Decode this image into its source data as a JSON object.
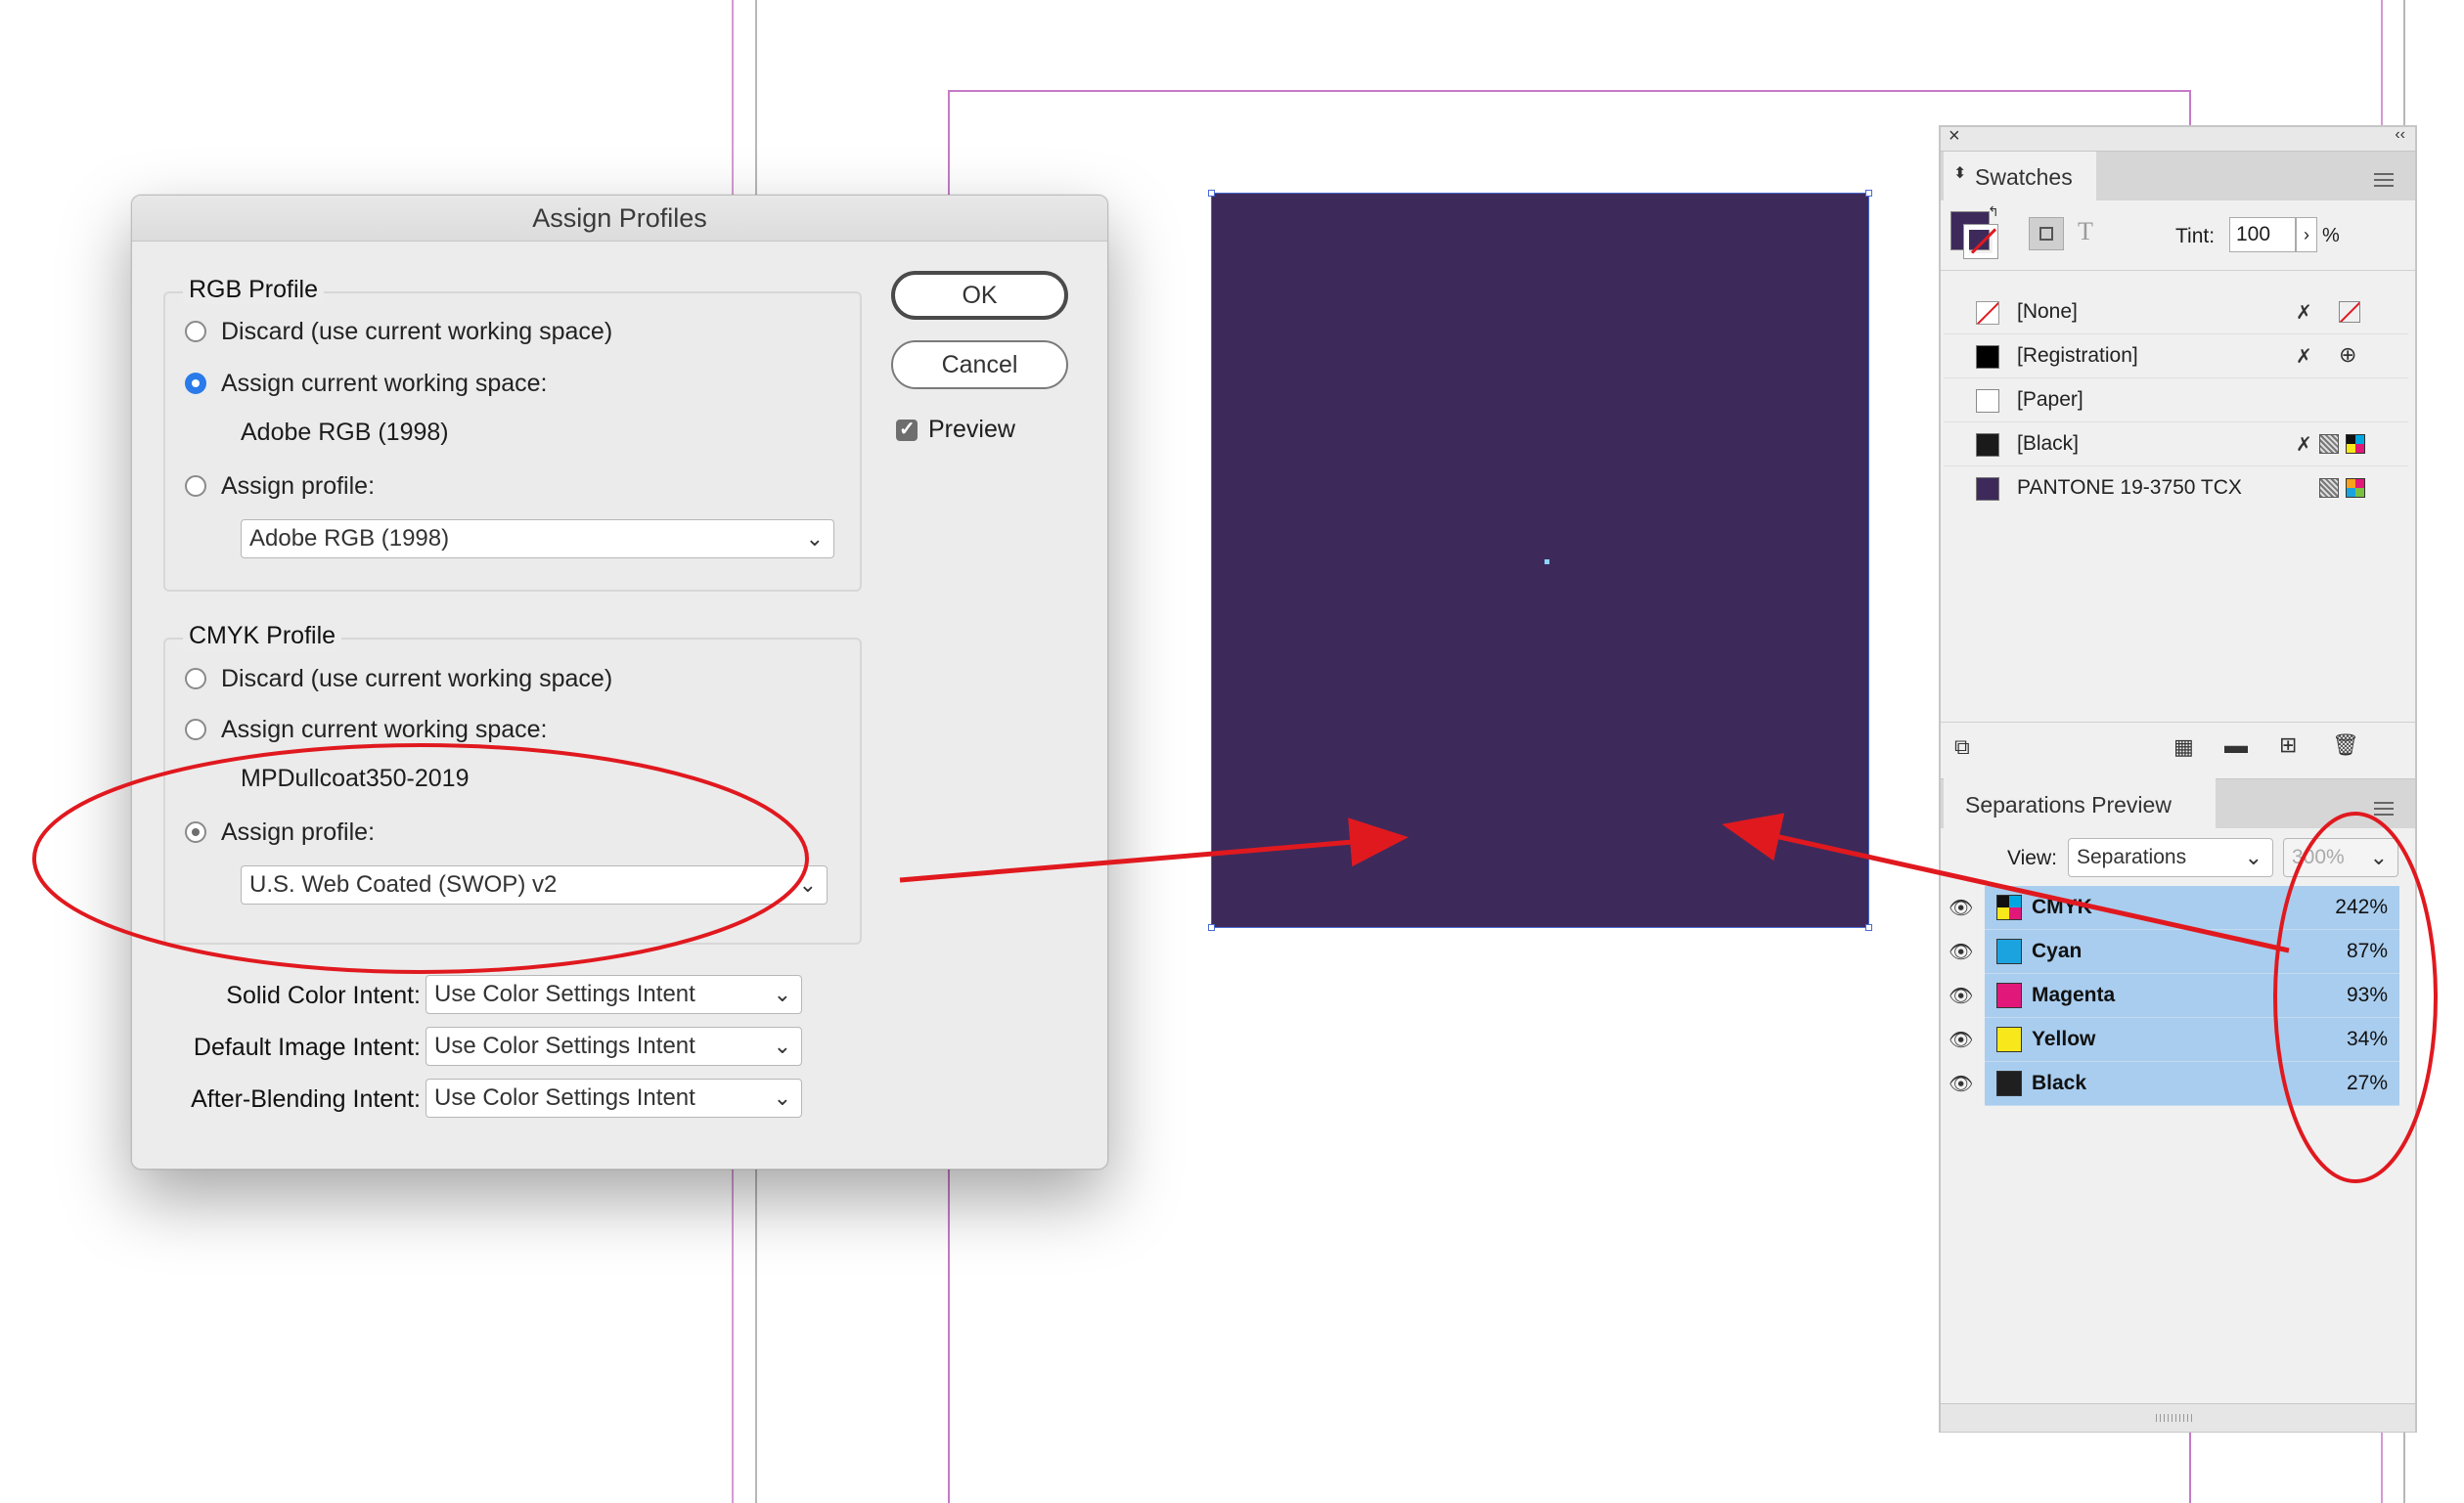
{
  "dialog": {
    "title": "Assign Profiles",
    "rgb": {
      "title": "RGB Profile",
      "discard_label": "Discard (use current working space)",
      "assign_current_label": "Assign current working space:",
      "current_space": "Adobe RGB (1998)",
      "assign_profile_label": "Assign profile:",
      "profile_select_value": "Adobe RGB (1998)",
      "selected": "assign_current"
    },
    "cmyk": {
      "title": "CMYK Profile",
      "discard_label": "Discard (use current working space)",
      "assign_current_label": "Assign current working space:",
      "current_space": "MPDullcoat350-2019",
      "assign_profile_label": "Assign profile:",
      "profile_select_value": "U.S. Web Coated (SWOP) v2",
      "selected": "assign_profile"
    },
    "buttons": {
      "ok": "OK",
      "cancel": "Cancel"
    },
    "preview": {
      "label": "Preview",
      "checked": true
    },
    "intents": [
      {
        "label": "Solid Color Intent:",
        "value": "Use Color Settings Intent"
      },
      {
        "label": "Default Image Intent:",
        "value": "Use Color Settings Intent"
      },
      {
        "label": "After-Blending Intent:",
        "value": "Use Color Settings Intent"
      }
    ]
  },
  "canvas": {
    "fill_color": "#3d2a5b"
  },
  "swatches_panel": {
    "tab_label": "Swatches",
    "tint_label": "Tint:",
    "tint_value": "100",
    "tint_unit": "%",
    "items": [
      {
        "name": "[None]",
        "color": "#ffffff"
      },
      {
        "name": "[Registration]",
        "color": "#000000"
      },
      {
        "name": "[Paper]",
        "color": "#ffffff"
      },
      {
        "name": "[Black]",
        "color": "#1a1a1a"
      },
      {
        "name": "PANTONE 19-3750 TCX",
        "color": "#3d2a5b"
      }
    ]
  },
  "separations_panel": {
    "tab_label": "Separations Preview",
    "view_label": "View:",
    "view_value": "Separations",
    "zoom_value": "300%",
    "rows": [
      {
        "name": "CMYK",
        "value": "242%",
        "color": "#222222"
      },
      {
        "name": "Cyan",
        "value": "87%",
        "color": "#1ba3e0"
      },
      {
        "name": "Magenta",
        "value": "93%",
        "color": "#e2177a"
      },
      {
        "name": "Yellow",
        "value": "34%",
        "color": "#f7e71b"
      },
      {
        "name": "Black",
        "value": "27%",
        "color": "#1f1f1f"
      }
    ]
  },
  "annotation_color": "#e0191f"
}
